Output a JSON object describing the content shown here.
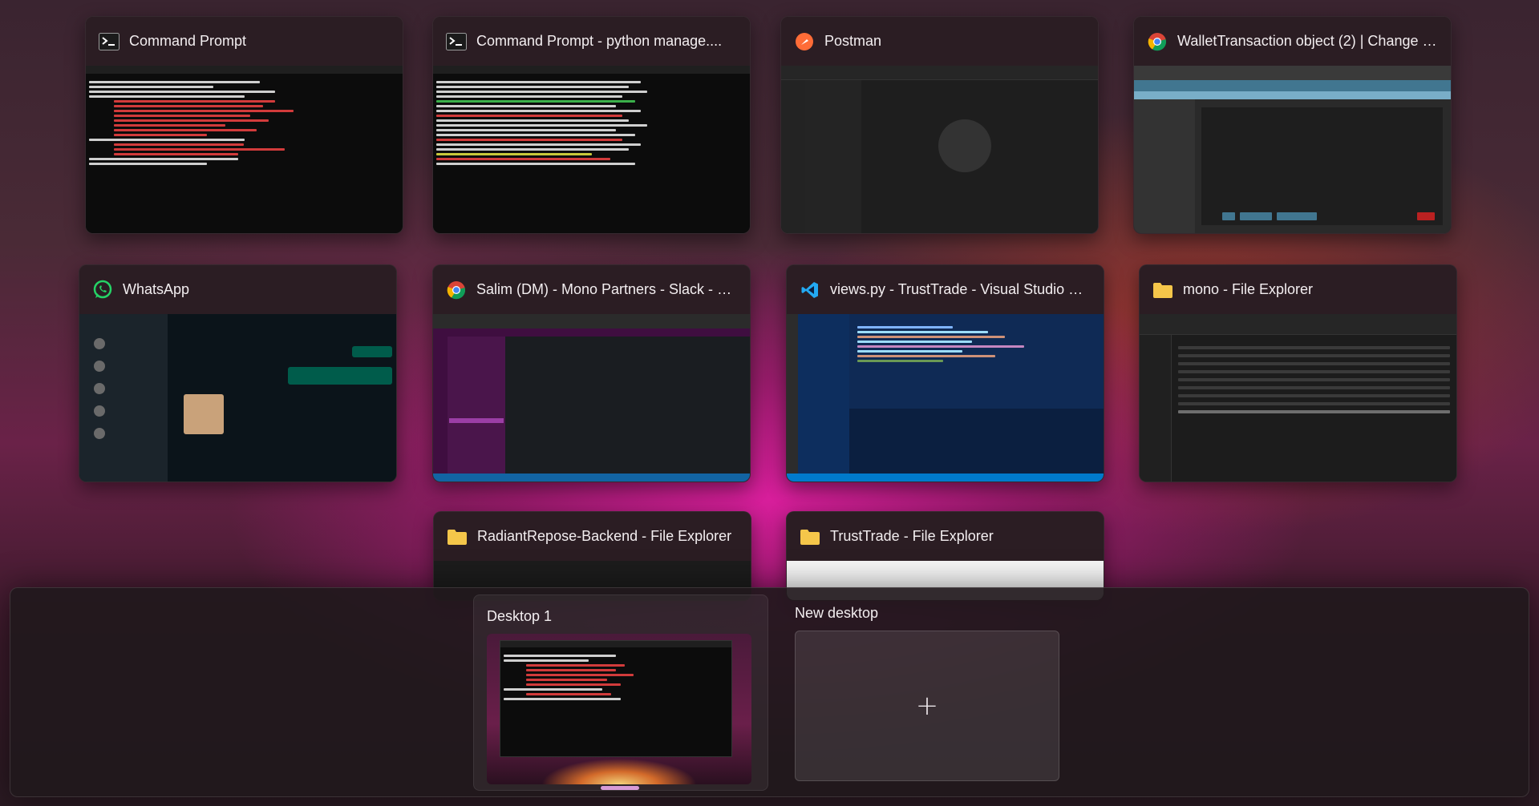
{
  "windows": [
    {
      "title": "Command Prompt",
      "icon": "terminal-icon"
    },
    {
      "title": "Command Prompt - python  manage....",
      "icon": "terminal-icon"
    },
    {
      "title": "Postman",
      "icon": "postman-icon"
    },
    {
      "title": "WalletTransaction object (2) | Change w...",
      "icon": "chrome-icon"
    },
    {
      "title": "WhatsApp",
      "icon": "whatsapp-icon"
    },
    {
      "title": "Salim (DM) - Mono Partners - Slack - G...",
      "icon": "chrome-icon"
    },
    {
      "title": "views.py - TrustTrade - Visual Studio Co...",
      "icon": "vscode-icon"
    },
    {
      "title": "mono - File Explorer",
      "icon": "folder-icon"
    },
    {
      "title": "RadiantRepose-Backend - File Explorer",
      "icon": "folder-icon"
    },
    {
      "title": "TrustTrade - File Explorer",
      "icon": "folder-icon"
    }
  ],
  "desktops": {
    "items": [
      {
        "label": "Desktop 1",
        "active": true
      },
      {
        "label": "New desktop",
        "active": false
      }
    ],
    "new_desktop_symbol": "+"
  },
  "colors": {
    "accent": "#d79bd6",
    "postman_orange": "#ff6c37",
    "whatsapp_green": "#25d366",
    "vscode_blue": "#23a9f2",
    "folder_yellow": "#f5c64a"
  }
}
